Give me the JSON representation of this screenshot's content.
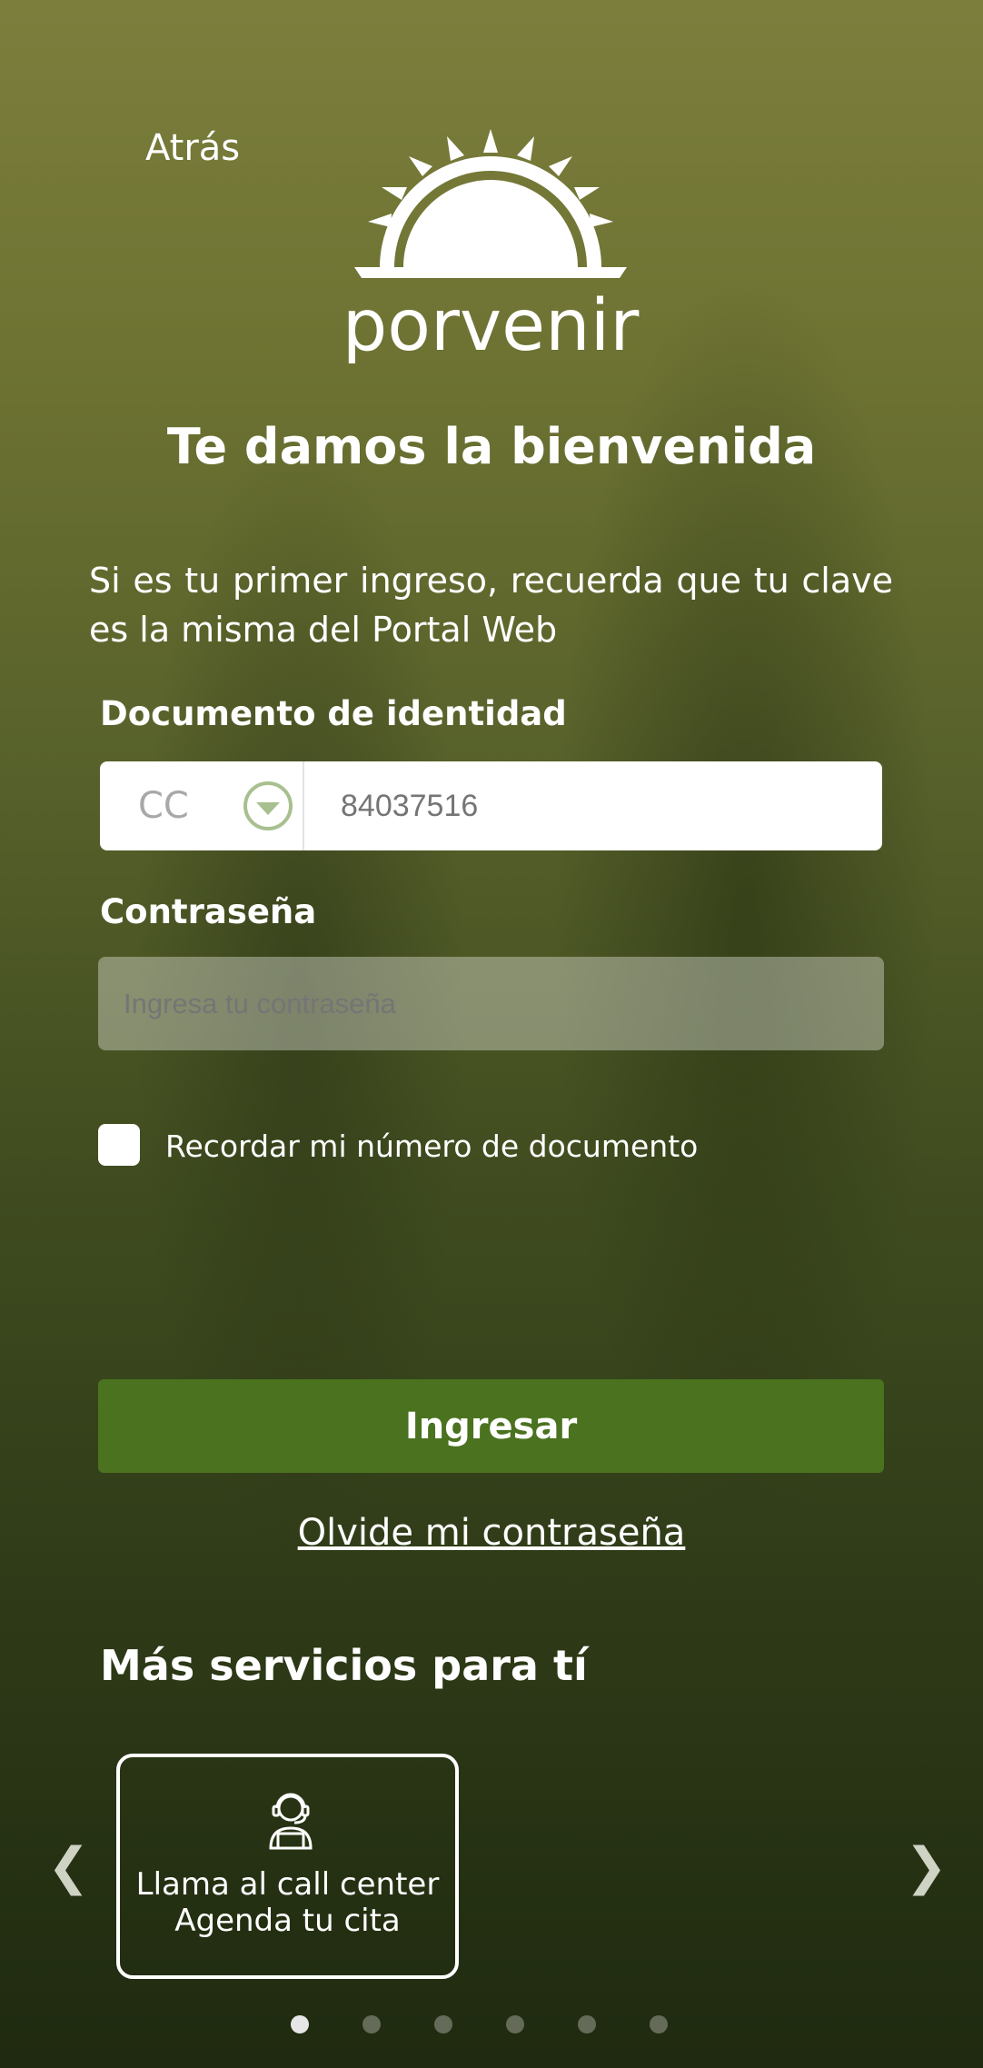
{
  "header": {
    "back_label": "Atrás",
    "logo_text": "porvenir"
  },
  "welcome": {
    "title": "Te damos la bienvenida",
    "intro": "Si es tu primer ingreso, recuerda que tu clave es la misma del Portal Web"
  },
  "form": {
    "document_label": "Documento de identidad",
    "document_type": "CC",
    "document_number_placeholder": "84037516",
    "password_label": "Contraseña",
    "password_placeholder": "Ingresa tu contraseña",
    "remember_label": "Recordar mi número de documento",
    "remember_checked": false,
    "submit_label": "Ingresar",
    "forgot_label": "Olvide mi contraseña"
  },
  "services": {
    "heading": "Más servicios para tí",
    "card_lines": [
      "Llama al call center",
      "Agenda tu cita"
    ],
    "prev_arrow": "❮",
    "next_arrow": "❯",
    "page_count": 6,
    "active_page": 1
  },
  "colors": {
    "primary_button": "#4b721f",
    "dropdown_accent": "#a8c090"
  },
  "icons": {
    "logo": "sun-logo-icon",
    "card": "call-center-agent-icon",
    "dropdown": "chevron-down-icon"
  }
}
